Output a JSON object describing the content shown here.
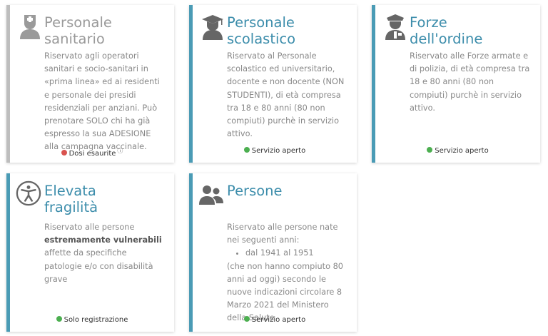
{
  "cards": [
    {
      "title_line1": "Personale",
      "title_line2": "sanitario",
      "icon": "doctor-icon",
      "description": "Riservato agli operatori sanitari e socio-sanitari in «prima linea» ed ai residenti e personale dei presidi residenziali per anziani. Può prenotare SOLO chi ha già espresso la sua ADESIONE alla campagna vaccinale.",
      "status": "Dosi esaurite",
      "status_color": "#d9534f",
      "enabled": false
    },
    {
      "title_line1": "Personale",
      "title_line2": "scolastico",
      "icon": "graduate-icon",
      "description": "Riservato al Personale scolastico ed universitario, docente e non docente (NON STUDENTI), di età compresa tra 18 e 80 anni (80 non compiuti) purchè in servizio attivo.",
      "status": "Servizio aperto",
      "status_color": "#4caf50",
      "enabled": true
    },
    {
      "title_line1": "Forze",
      "title_line2": "dell'ordine",
      "icon": "police-officer-icon",
      "description": "Riservato alle Forze armate e di polizia, di età compresa tra 18 e 80 anni (80 non compiuti) purchè in servizio attivo.",
      "status": "Servizio aperto",
      "status_color": "#4caf50",
      "enabled": true
    },
    {
      "title_line1": "Elevata",
      "title_line2": "fragilità",
      "icon": "accessibility-icon",
      "description_pre": "Riservato alle persone",
      "description_bold": "estremamente vulnerabili",
      "description_post": "affette da specifiche patologie e/o con disabilità grave",
      "status": "Solo registrazione",
      "status_color": "#4caf50",
      "enabled": true
    },
    {
      "title_line1": "Persone",
      "title_line2": "",
      "icon": "users-icon",
      "description_pre": "Riservato alle persone nate nei seguenti anni:",
      "description_item": "dal 1941 al 1951",
      "description_post": "(che non hanno compiuto 80 anni ad oggi) secondo le nuove indicazioni circolare 8 Marzo 2021 del Ministero della Salute",
      "status": "Servizio aperto",
      "status_color": "#4caf50",
      "enabled": true
    }
  ]
}
